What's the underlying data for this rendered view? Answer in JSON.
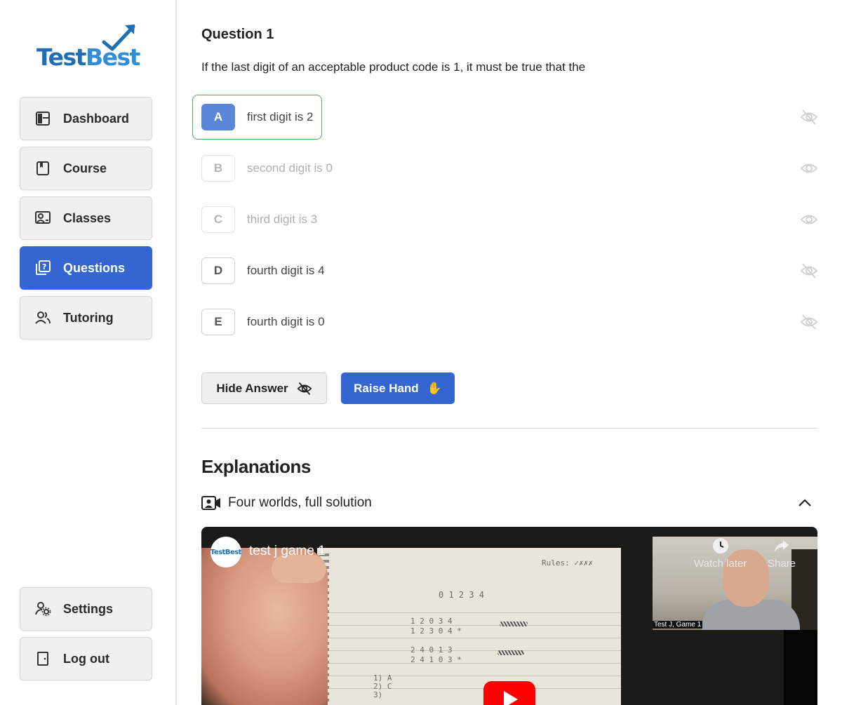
{
  "brand": {
    "logo_part1": "Test",
    "logo_part2": "Best"
  },
  "sidebar": {
    "items": [
      {
        "label": "Dashboard",
        "icon": "dashboard-icon",
        "active": false
      },
      {
        "label": "Course",
        "icon": "book-icon",
        "active": false
      },
      {
        "label": "Classes",
        "icon": "classes-icon",
        "active": false
      },
      {
        "label": "Questions",
        "icon": "questions-icon",
        "active": true
      },
      {
        "label": "Tutoring",
        "icon": "people-icon",
        "active": false
      }
    ],
    "bottom": [
      {
        "label": "Settings",
        "icon": "user-settings-icon"
      },
      {
        "label": "Log out",
        "icon": "door-icon"
      }
    ]
  },
  "question": {
    "title": "Question 1",
    "text": "If the last digit of an acceptable product code is 1, it must be true that the",
    "choices": [
      {
        "letter": "A",
        "text": "first digit is 2",
        "state": "selected",
        "eye": "eye-off-icon"
      },
      {
        "letter": "B",
        "text": "second digit is 0",
        "state": "faded",
        "eye": "eye-icon"
      },
      {
        "letter": "C",
        "text": "third digit is 3",
        "state": "faded",
        "eye": "eye-icon"
      },
      {
        "letter": "D",
        "text": "fourth digit is 4",
        "state": "normal",
        "eye": "eye-off-icon"
      },
      {
        "letter": "E",
        "text": "fourth digit is 0",
        "state": "normal",
        "eye": "eye-off-icon"
      }
    ]
  },
  "buttons": {
    "hide_answer": "Hide Answer",
    "raise_hand": "Raise Hand",
    "raise_hand_emoji": "✋"
  },
  "explanations": {
    "title": "Explanations",
    "item_title": "Four worlds, full solution",
    "video": {
      "title": "test j game 1",
      "channel_badge": "TestBest",
      "watch_later": "Watch later",
      "share": "Share",
      "pip_caption": "Test J, Game 1",
      "handwriting": {
        "rules": "Rules: ✓✗✗✗",
        "digits": "0 1 2 3 4",
        "row1_top": "1  2  0  3  4",
        "row1_bottom": "1  2  3  0  4 *",
        "row2_top": "2  4  0  1  3",
        "row2_bottom": "2  4  1  0  3 *",
        "answers": "1) A\n2) C\n3)"
      }
    }
  },
  "colors": {
    "accent": "#3465d1",
    "selected_letter": "#5b87d9",
    "selected_border": "#4caf50",
    "logo_dark": "#1f6fb5",
    "logo_light": "#2e8fd8"
  }
}
